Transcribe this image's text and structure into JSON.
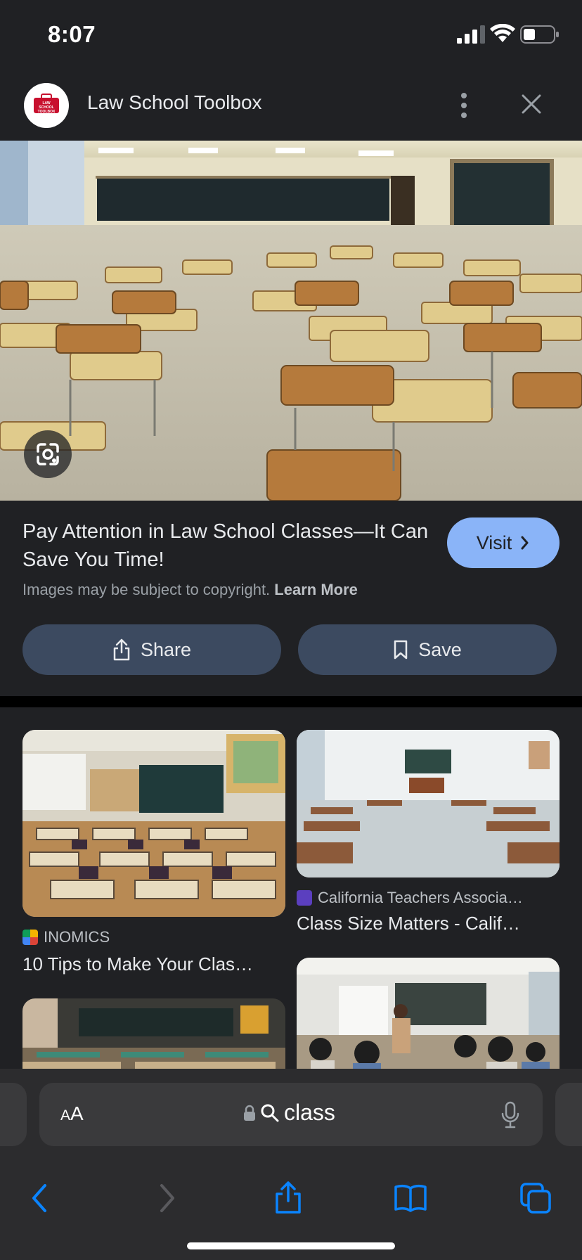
{
  "status_bar": {
    "time": "8:07"
  },
  "header": {
    "site_name": "Law School Toolbox",
    "logo_text": "LAW SCHOOL TOOLBOX"
  },
  "result": {
    "title": "Pay Attention in Law School Classes—It Can Save You Time!",
    "visit_label": "Visit",
    "copyright_text": "Images may be subject to copyright.",
    "learn_more": "Learn More",
    "share_label": "Share",
    "save_label": "Save"
  },
  "related": [
    {
      "source": "INOMICS",
      "title": "10 Tips to Make Your Clas…"
    },
    {
      "source": "California Teachers Associa…",
      "title": "Class Size Matters - Calif…"
    }
  ],
  "address_bar": {
    "aa_label": "AA",
    "query": "class"
  },
  "colors": {
    "accent": "#8ab4f8",
    "background": "#202124",
    "button": "#3c4a60",
    "safari_blue": "#0a84ff"
  }
}
